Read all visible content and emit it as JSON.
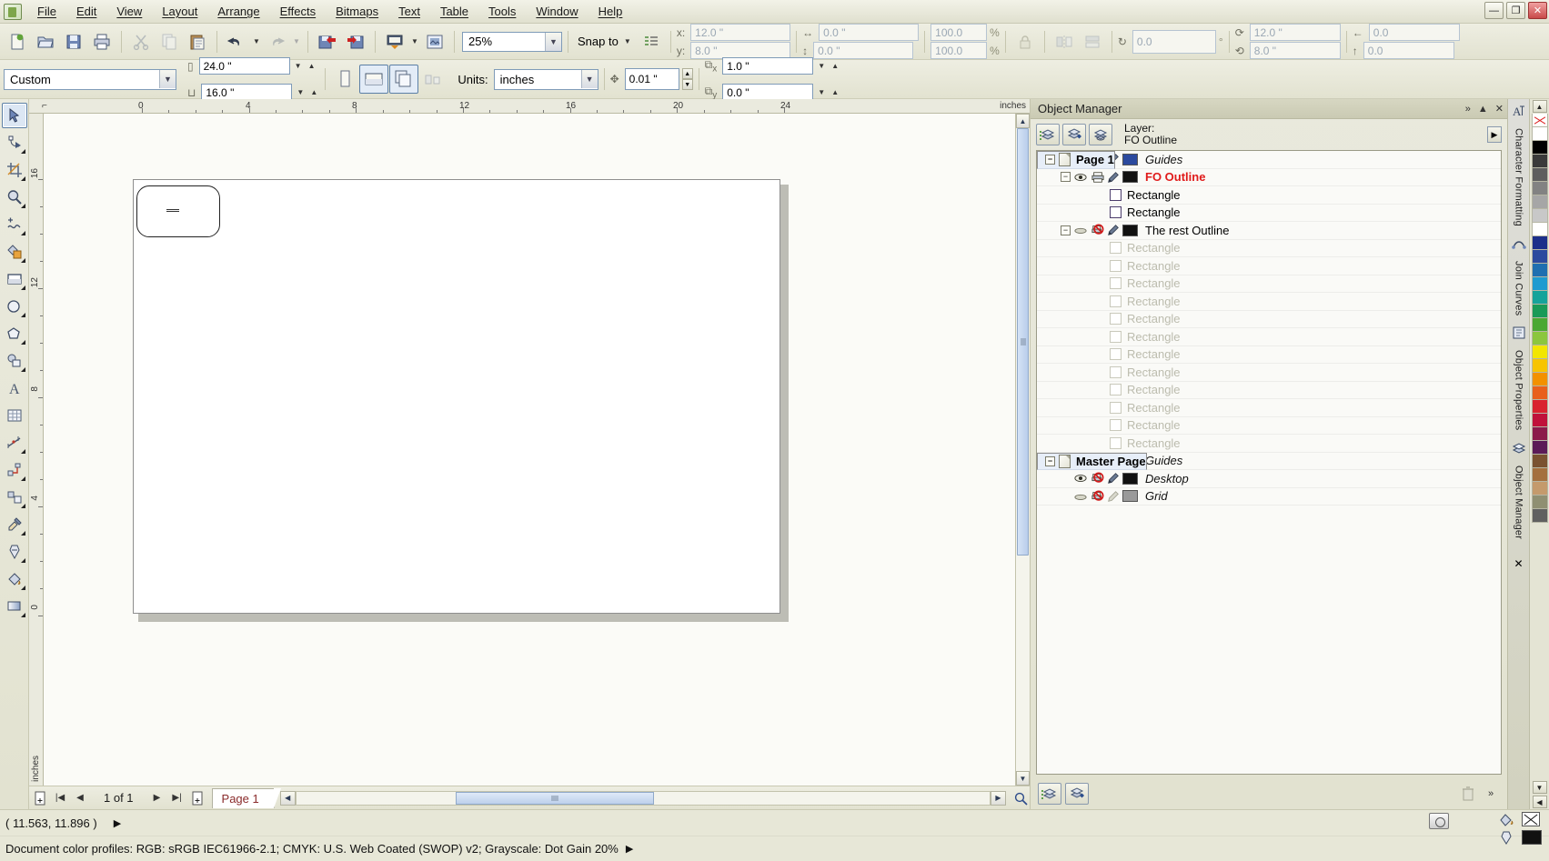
{
  "app": {
    "title_icon": "coreldraw-icon",
    "window_buttons": [
      {
        "name": "minimize",
        "glyph": "—"
      },
      {
        "name": "restore",
        "glyph": "❐"
      },
      {
        "name": "close",
        "glyph": "✕"
      }
    ]
  },
  "menubar": {
    "items": [
      {
        "label": "File",
        "accel": "F"
      },
      {
        "label": "Edit",
        "accel": "E"
      },
      {
        "label": "View",
        "accel": "V"
      },
      {
        "label": "Layout",
        "accel": "L"
      },
      {
        "label": "Arrange",
        "accel": "A"
      },
      {
        "label": "Effects",
        "accel": "c"
      },
      {
        "label": "Bitmaps",
        "accel": "B"
      },
      {
        "label": "Text",
        "accel": "x"
      },
      {
        "label": "Table",
        "accel": "T"
      },
      {
        "label": "Tools",
        "accel": "o"
      },
      {
        "label": "Window",
        "accel": "W"
      },
      {
        "label": "Help",
        "accel": "H"
      }
    ]
  },
  "standard_toolbar": {
    "buttons": [
      {
        "name": "new-document-button",
        "icon": "new-doc-icon"
      },
      {
        "name": "open-button",
        "icon": "folder-open-icon"
      },
      {
        "name": "save-button",
        "icon": "floppy-save-icon"
      },
      {
        "name": "print-button",
        "icon": "printer-icon"
      },
      {
        "name": "cut-button",
        "icon": "scissors-icon"
      },
      {
        "name": "copy-button",
        "icon": "copy-icon"
      },
      {
        "name": "paste-button",
        "icon": "clipboard-paste-icon"
      },
      {
        "name": "undo-button",
        "icon": "undo-arrow-icon"
      },
      {
        "name": "redo-button",
        "icon": "redo-arrow-icon"
      },
      {
        "name": "import-button",
        "icon": "import-icon"
      },
      {
        "name": "export-button",
        "icon": "export-icon"
      },
      {
        "name": "publish-pdf-button",
        "icon": "pdf-publish-icon"
      },
      {
        "name": "application-launcher-button",
        "icon": "app-launcher-icon"
      }
    ],
    "zoom_level": "25%",
    "snap_to_label": "Snap to",
    "options_button": "options-icon"
  },
  "property_bar": {
    "x_label": "x:",
    "x_value": "12.0 \"",
    "y_label": "y:",
    "y_value": "8.0 \"",
    "width_value": "0.0 \"",
    "height_value": "0.0 \"",
    "scale_h": "100.0",
    "scale_v": "100.0",
    "percent": "%",
    "lock_ratio_icon": "lock-icon",
    "mirror_h_icon": "mirror-horizontal-icon",
    "mirror_v_icon": "mirror-vertical-icon",
    "rotation_value": "0.0",
    "degree_symbol": "°",
    "center_x": "12.0 \"",
    "center_y": "8.0 \"",
    "outline_a": "0.0",
    "outline_b": "0.0"
  },
  "page_toolbar": {
    "preset": "Custom",
    "page_width": "24.0 \"",
    "page_height": "16.0 \"",
    "orientation_portrait_icon": "portrait-icon",
    "orientation_landscape_icon": "landscape-icon",
    "all_pages_icon": "all-pages-icon",
    "current_page_icon": "current-page-icon",
    "units_label": "Units:",
    "units_value": "inches",
    "nudge_value": "0.01 \"",
    "duplicate_x_label": "x",
    "duplicate_x": "1.0 \"",
    "duplicate_y_label": "y",
    "duplicate_y": "0.0 \""
  },
  "toolbox": {
    "tools": [
      {
        "name": "pick-tool",
        "icon": "arrow-cursor-icon",
        "selected": true,
        "flyout": false
      },
      {
        "name": "shape-tool",
        "icon": "shape-node-icon",
        "selected": false,
        "flyout": true
      },
      {
        "name": "crop-tool",
        "icon": "crop-icon",
        "selected": false,
        "flyout": true
      },
      {
        "name": "zoom-tool",
        "icon": "magnifier-icon",
        "selected": false,
        "flyout": true
      },
      {
        "name": "freehand-tool",
        "icon": "freehand-curve-icon",
        "selected": false,
        "flyout": true
      },
      {
        "name": "smart-fill-tool",
        "icon": "smart-fill-icon",
        "selected": false,
        "flyout": true
      },
      {
        "name": "rectangle-tool",
        "icon": "rectangle-icon",
        "selected": false,
        "flyout": true
      },
      {
        "name": "ellipse-tool",
        "icon": "ellipse-icon",
        "selected": false,
        "flyout": true
      },
      {
        "name": "polygon-tool",
        "icon": "polygon-icon",
        "selected": false,
        "flyout": true
      },
      {
        "name": "basic-shapes-tool",
        "icon": "basic-shapes-icon",
        "selected": false,
        "flyout": true
      },
      {
        "name": "text-tool",
        "icon": "letter-a-icon",
        "selected": false,
        "flyout": false
      },
      {
        "name": "table-tool",
        "icon": "table-grid-icon",
        "selected": false,
        "flyout": false
      },
      {
        "name": "dimension-tool",
        "icon": "dimension-icon",
        "selected": false,
        "flyout": true
      },
      {
        "name": "connector-tool",
        "icon": "connector-icon",
        "selected": false,
        "flyout": true
      },
      {
        "name": "blend-tool",
        "icon": "blend-icon",
        "selected": false,
        "flyout": true
      },
      {
        "name": "color-eyedropper-tool",
        "icon": "eyedropper-icon",
        "selected": false,
        "flyout": true
      },
      {
        "name": "outline-tool",
        "icon": "pen-nib-icon",
        "selected": false,
        "flyout": true
      },
      {
        "name": "fill-tool",
        "icon": "paint-bucket-icon",
        "selected": false,
        "flyout": true
      },
      {
        "name": "interactive-fill-tool",
        "icon": "interactive-fill-icon",
        "selected": false,
        "flyout": true
      }
    ]
  },
  "rulers": {
    "horizontal_ticks": [
      "0",
      "4",
      "8",
      "12",
      "16",
      "20",
      "24"
    ],
    "horizontal_unit": "inches",
    "vertical_ticks": [
      "16",
      "12",
      "8",
      "4",
      "0"
    ],
    "vertical_unit": "inches"
  },
  "docker": {
    "title": "Object Manager",
    "title_actions": [
      {
        "name": "docker-expand-button",
        "glyph": "»"
      },
      {
        "name": "docker-collapse-button",
        "glyph": "▲"
      },
      {
        "name": "docker-close-button",
        "glyph": "✕"
      }
    ],
    "head_buttons": [
      {
        "name": "new-layer-button",
        "icon": "new-layer-icon"
      },
      {
        "name": "new-master-layer-button",
        "icon": "new-master-layer-icon"
      },
      {
        "name": "layer-manager-view-button",
        "icon": "layer-view-icon"
      }
    ],
    "layer_caption": "Layer:",
    "layer_name": "FO Outline",
    "flyout_button": "docker-flyout-icon",
    "tree": [
      {
        "type": "page",
        "label": "Page 1",
        "indent": 0,
        "expander": "−",
        "icon": "page-icon"
      },
      {
        "type": "layer",
        "label": "Guides",
        "indent": 1,
        "style": "guides",
        "eye": true,
        "print": "no-print",
        "pen": true,
        "swatch": "#2c4a9e"
      },
      {
        "type": "layer",
        "label": "FO Outline",
        "indent": 1,
        "style": "active",
        "expander": "−",
        "eye": true,
        "print": "print",
        "pen": true,
        "swatch": "#111111"
      },
      {
        "type": "object",
        "label": "Rectangle",
        "indent": 2,
        "dimmed": false
      },
      {
        "type": "object",
        "label": "Rectangle",
        "indent": 2,
        "dimmed": false
      },
      {
        "type": "layer",
        "label": "The rest Outline",
        "indent": 1,
        "style": "normal",
        "expander": "−",
        "eye": false,
        "print": "no-print",
        "pen": true,
        "swatch": "#111111"
      },
      {
        "type": "object",
        "label": "Rectangle",
        "indent": 2,
        "dimmed": true
      },
      {
        "type": "object",
        "label": "Rectangle",
        "indent": 2,
        "dimmed": true
      },
      {
        "type": "object",
        "label": "Rectangle",
        "indent": 2,
        "dimmed": true
      },
      {
        "type": "object",
        "label": "Rectangle",
        "indent": 2,
        "dimmed": true
      },
      {
        "type": "object",
        "label": "Rectangle",
        "indent": 2,
        "dimmed": true
      },
      {
        "type": "object",
        "label": "Rectangle",
        "indent": 2,
        "dimmed": true
      },
      {
        "type": "object",
        "label": "Rectangle",
        "indent": 2,
        "dimmed": true
      },
      {
        "type": "object",
        "label": "Rectangle",
        "indent": 2,
        "dimmed": true
      },
      {
        "type": "object",
        "label": "Rectangle",
        "indent": 2,
        "dimmed": true
      },
      {
        "type": "object",
        "label": "Rectangle",
        "indent": 2,
        "dimmed": true
      },
      {
        "type": "object",
        "label": "Rectangle",
        "indent": 2,
        "dimmed": true
      },
      {
        "type": "object",
        "label": "Rectangle",
        "indent": 2,
        "dimmed": true
      },
      {
        "type": "page",
        "label": "Master Page",
        "indent": 0,
        "expander": "−",
        "icon": "page-icon"
      },
      {
        "type": "layer",
        "label": "Guides",
        "indent": 1,
        "style": "guides",
        "eye": true,
        "print": "no-print",
        "pen": true,
        "swatch": "#2c4a9e"
      },
      {
        "type": "layer",
        "label": "Desktop",
        "indent": 1,
        "style": "guides",
        "eye": true,
        "print": "no-print",
        "pen": true,
        "swatch": "#111111"
      },
      {
        "type": "layer",
        "label": "Grid",
        "indent": 1,
        "style": "guides",
        "eye": false,
        "print": "no-print",
        "pen": "disabled",
        "swatch": "#9a9a9a"
      }
    ],
    "footer_buttons": [
      {
        "name": "new-layer-footer-button",
        "icon": "new-layer-icon"
      },
      {
        "name": "new-master-layer-footer-button",
        "icon": "new-master-layer-icon"
      },
      {
        "name": "delete-layer-button",
        "icon": "trash-icon"
      },
      {
        "name": "docker-more-button",
        "glyph": "»"
      }
    ]
  },
  "docker_tabs": [
    {
      "name": "tab-character-formatting",
      "label": "Character Formatting"
    },
    {
      "name": "tab-join-curves",
      "label": "Join Curves"
    },
    {
      "name": "tab-object-properties",
      "label": "Object Properties"
    },
    {
      "name": "tab-object-manager",
      "label": "Object Manager"
    }
  ],
  "palette": {
    "no_color_label": "no-color-swatch",
    "colors": [
      "#ffffff",
      "#000000",
      "#3a3a3a",
      "#5e5e5e",
      "#828282",
      "#a6a6a6",
      "#c8c8c8",
      "#ffffff",
      "#1c2f8a",
      "#2c4a9e",
      "#1f6fb0",
      "#1e9bd0",
      "#15a39a",
      "#199a57",
      "#4aa832",
      "#8cc63e",
      "#f2e600",
      "#f7c400",
      "#f29100",
      "#e8601c",
      "#d9232e",
      "#c0123a",
      "#8c1b4b",
      "#5b1b57",
      "#7a5230",
      "#a4703e",
      "#c49a6c",
      "#8f8f72",
      "#606060"
    ]
  },
  "page_nav": {
    "add_page_start_icon": "add-page-icon",
    "first_icon": "first-page-icon",
    "prev_icon": "prev-page-icon",
    "counter": "1 of 1",
    "next_icon": "next-page-icon",
    "last_icon": "last-page-icon",
    "add_page_end_icon": "add-page-icon",
    "tab_label": "Page 1"
  },
  "status_bar": {
    "coordinates": "( 11.563, 11.896 )",
    "color_profiles": "Document color profiles: RGB: sRGB IEC61966-2.1; CMYK: U.S. Web Coated (SWOP) v2; Grayscale: Dot Gain 20%",
    "expand_arrow": "▶",
    "snapshot_icon": "camera-icon",
    "fill_icon": "fill-color-icon",
    "outline_icon": "outline-color-icon",
    "fill_swatch": "#111111",
    "outline_swatch": "no-color"
  },
  "document": {
    "page_shape_label": "rounded-rectangle-shape"
  }
}
